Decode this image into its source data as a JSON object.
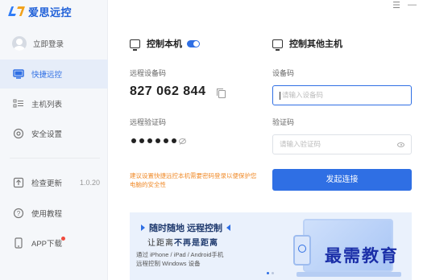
{
  "app": {
    "logo_text": "爱思远控",
    "window_controls": [
      "☰",
      "—"
    ]
  },
  "sidebar": {
    "login": "立即登录",
    "items": [
      {
        "label": "快捷远控",
        "icon": "monitor-icon",
        "active": true
      },
      {
        "label": "主机列表",
        "icon": "list-icon"
      },
      {
        "label": "安全设置",
        "icon": "shield-icon"
      }
    ],
    "bottom": [
      {
        "label": "检查更新",
        "icon": "upload-icon",
        "version": "1.0.20"
      },
      {
        "label": "使用教程",
        "icon": "help-icon"
      },
      {
        "label": "APP下载",
        "icon": "phone-icon",
        "badge": true
      }
    ]
  },
  "local": {
    "title": "控制本机",
    "toggle_on": true,
    "code_label": "远程设备码",
    "code_value": "827 062 844",
    "pwd_label": "远程验证码",
    "pwd_masked": true,
    "warning": "建议设置快捷远控本机需要密码登录以便保护您电脑的安全性"
  },
  "remote": {
    "title": "控制其他主机",
    "device_label": "设备码",
    "device_placeholder": "请输入设备码",
    "verify_label": "验证码",
    "verify_placeholder": "请输入验证码",
    "connect_button": "发起连接"
  },
  "banner": {
    "title": "随时随地 远程控制",
    "subtitle_pre": "让距离",
    "subtitle_bold": "不再是距离",
    "line1": "通过 iPhone / iPad / Android手机",
    "line2": "远程控制 Windows 设备"
  },
  "watermark": "最需教育",
  "colors": {
    "accent": "#2f6fe4",
    "warning": "#f08b2a",
    "sidebar_bg": "#f5f7fa",
    "banner_bg": "#eaf1fc"
  }
}
